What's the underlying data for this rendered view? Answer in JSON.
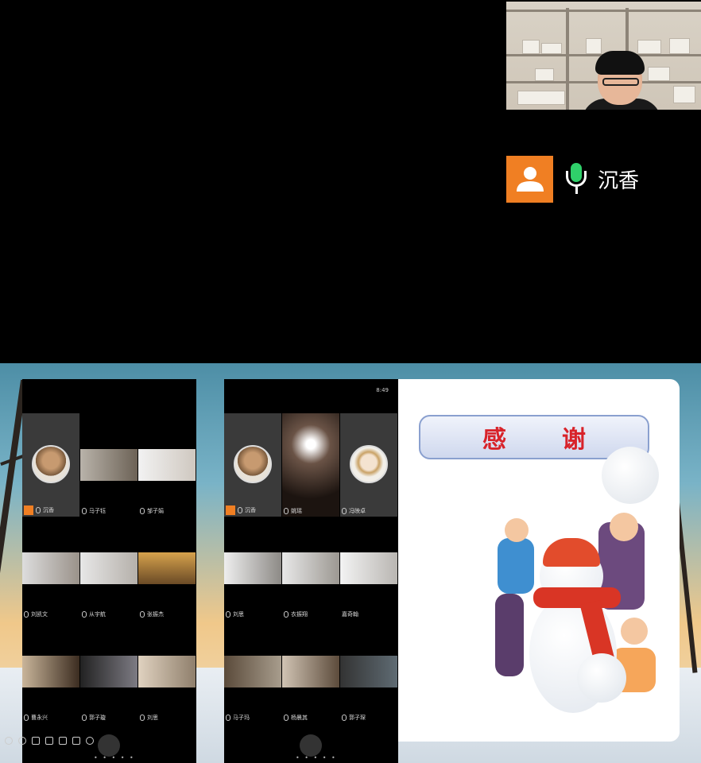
{
  "speaker": {
    "name": "沉香"
  },
  "slide": {
    "banner_text": "感谢"
  },
  "phone1": {
    "tiles": [
      {
        "name": "沉香",
        "type": "host"
      },
      {
        "name": "马子钰",
        "type": "mic"
      },
      {
        "name": "邹子娟",
        "type": "mic"
      },
      {
        "name": "刘凯文",
        "type": "mic"
      },
      {
        "name": "从宇航",
        "type": "mic"
      },
      {
        "name": "张振杰",
        "type": "mic"
      },
      {
        "name": "曹永兴",
        "type": "mic"
      },
      {
        "name": "郭子璇",
        "type": "mic"
      },
      {
        "name": "刘思",
        "type": "mic"
      }
    ]
  },
  "phone2": {
    "status_time": "8:49",
    "tiles": [
      {
        "name": "沉香",
        "type": "host"
      },
      {
        "name": "姚瑶",
        "type": "mic"
      },
      {
        "name": "冯映卓",
        "type": "mic"
      },
      {
        "name": "刘思",
        "type": "mic"
      },
      {
        "name": "衣振翔",
        "type": "mic"
      },
      {
        "name": "嘉奇翰",
        "type": "none"
      },
      {
        "name": "马子玛",
        "type": "mic"
      },
      {
        "name": "杨晨其",
        "type": "mic"
      },
      {
        "name": "郭子琛",
        "type": "mic"
      }
    ]
  },
  "colors": {
    "accent": "#f07f23",
    "mic_active": "#2fd06a",
    "banner_text": "#d8232a"
  }
}
